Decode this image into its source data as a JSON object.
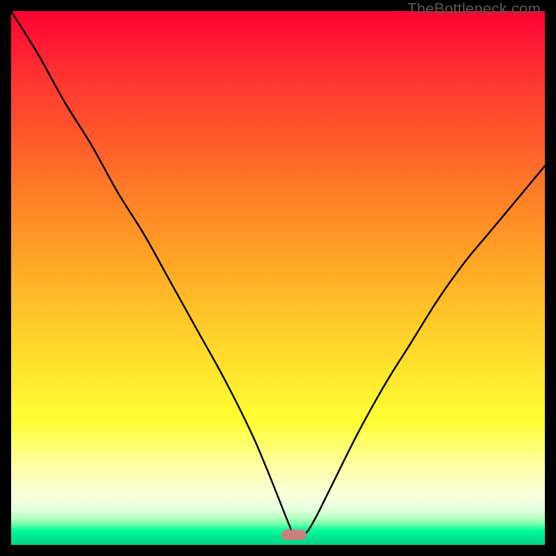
{
  "watermark": "TheBottleneck.com",
  "colors": {
    "marker": "#cc7f7f",
    "curve": "#000000",
    "frame": "#000000"
  },
  "chart_data": {
    "type": "line",
    "title": "",
    "xlabel": "",
    "ylabel": "",
    "xlim": [
      0,
      100
    ],
    "ylim": [
      0,
      100
    ],
    "grid": false,
    "legend": false,
    "notes": "V-shaped bottleneck curve over vertical red→green gradient (red = bottleneck, green = balanced). Minimum marked by rounded pink capsule near x≈53.",
    "series": [
      {
        "name": "bottleneck-curve",
        "x": [
          0,
          5,
          10,
          15,
          20,
          25,
          30,
          35,
          40,
          45,
          48,
          50,
          52,
          53,
          55,
          57,
          60,
          65,
          70,
          75,
          80,
          85,
          90,
          95,
          100
        ],
        "values": [
          100,
          92,
          83,
          75,
          66,
          58,
          49,
          40,
          31,
          21,
          14,
          9,
          4,
          2,
          2,
          5,
          11,
          21,
          30,
          38,
          46,
          53,
          59,
          65,
          71
        ]
      }
    ],
    "marker": {
      "x": 53,
      "width_pct": 4.8,
      "y": 2
    }
  }
}
